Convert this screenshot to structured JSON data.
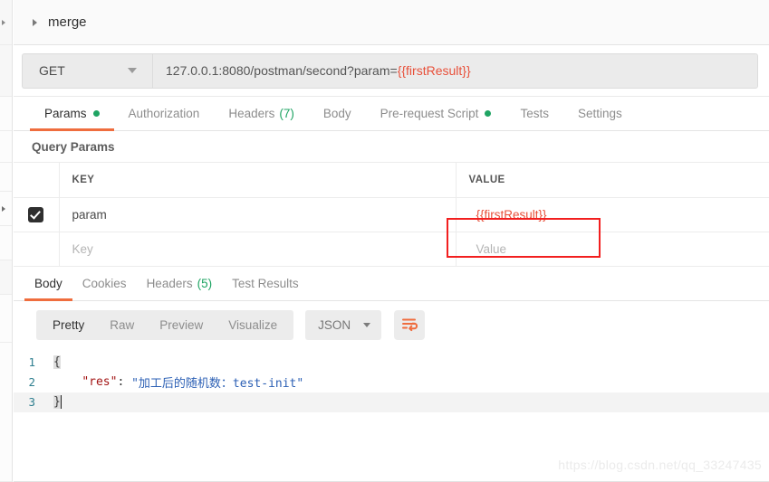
{
  "sidebar": {
    "caret_icon": "caret-right-icon"
  },
  "folder": {
    "caret_icon": "caret-right-icon",
    "title": "merge"
  },
  "request": {
    "method": "GET",
    "method_caret_icon": "chevron-down-icon",
    "url_prefix": "127.0.0.1:8080/postman/second?param=",
    "url_variable": "{{firstResult}}",
    "tabs": [
      {
        "label": "Params",
        "active": true,
        "dot": true,
        "count": ""
      },
      {
        "label": "Authorization",
        "active": false,
        "dot": false,
        "count": ""
      },
      {
        "label": "Headers",
        "active": false,
        "dot": false,
        "count": "(7)"
      },
      {
        "label": "Body",
        "active": false,
        "dot": false,
        "count": ""
      },
      {
        "label": "Pre-request Script",
        "active": false,
        "dot": true,
        "count": ""
      },
      {
        "label": "Tests",
        "active": false,
        "dot": false,
        "count": ""
      },
      {
        "label": "Settings",
        "active": false,
        "dot": false,
        "count": ""
      }
    ]
  },
  "query_params": {
    "section_title": "Query Params",
    "columns": {
      "key": "KEY",
      "value": "VALUE"
    },
    "rows": [
      {
        "checked": true,
        "key": "param",
        "value": "{{firstResult}}",
        "highlighted": true
      }
    ],
    "empty_row": {
      "key_placeholder": "Key",
      "value_placeholder": "Value"
    }
  },
  "response": {
    "tabs": [
      {
        "label": "Body",
        "active": true,
        "count": ""
      },
      {
        "label": "Cookies",
        "active": false,
        "count": ""
      },
      {
        "label": "Headers",
        "active": false,
        "count": "(5)"
      },
      {
        "label": "Test Results",
        "active": false,
        "count": ""
      }
    ],
    "formats": [
      {
        "label": "Pretty",
        "active": true
      },
      {
        "label": "Raw",
        "active": false
      },
      {
        "label": "Preview",
        "active": false
      },
      {
        "label": "Visualize",
        "active": false
      }
    ],
    "language": "JSON",
    "language_caret_icon": "chevron-down-icon",
    "wrap_icon": "word-wrap-icon",
    "body_lines": [
      {
        "no": "1",
        "open_brace": "{",
        "key": "",
        "value": "",
        "close_brace": ""
      },
      {
        "no": "2",
        "open_brace": "",
        "key": "\"res\"",
        "sep": ": ",
        "value": "\"加工后的随机数：test-init\"",
        "close_brace": ""
      },
      {
        "no": "3",
        "open_brace": "",
        "key": "",
        "value": "",
        "close_brace": "}"
      }
    ]
  },
  "watermark": "https://blog.csdn.net/qq_33247435",
  "colors": {
    "accent_orange": "#ef6d3e",
    "variable_red": "#e8503a",
    "annotation_red": "#f21f1f",
    "status_green": "#1fa463",
    "json_key": "#a31515",
    "json_value": "#2b5fb4",
    "line_number": "#2f7f8f"
  }
}
